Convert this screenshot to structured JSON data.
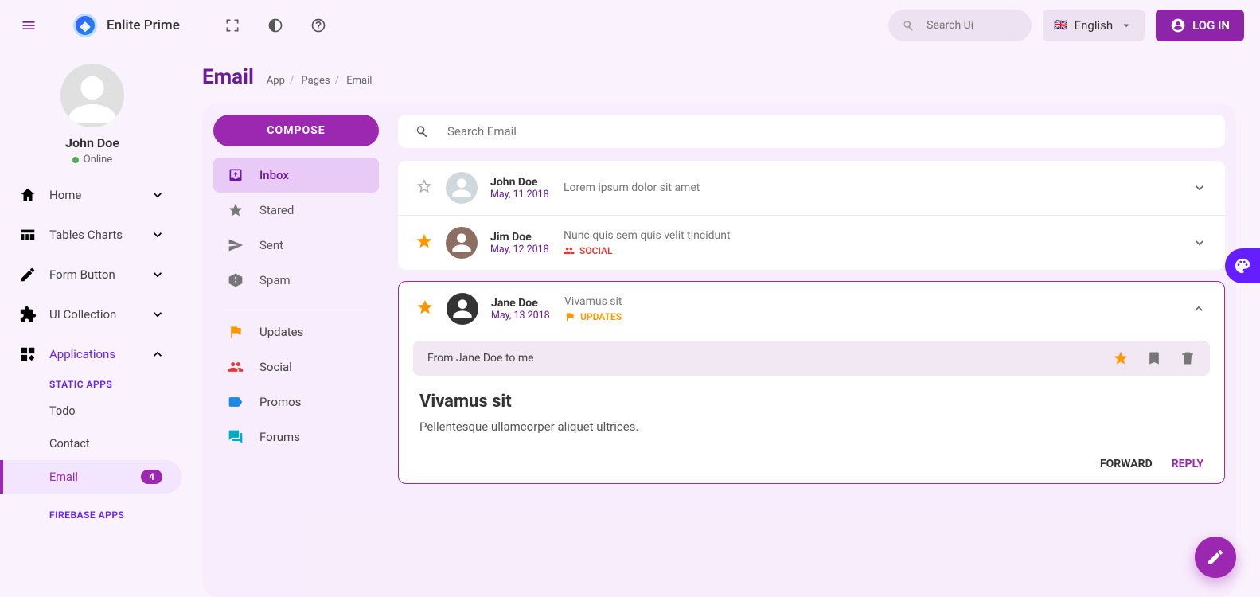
{
  "app": {
    "name": "Enlite Prime"
  },
  "topbar": {
    "search_placeholder": "Search Ui",
    "language": "English",
    "login": "LOG IN"
  },
  "profile": {
    "name": "John Doe",
    "status": "Online"
  },
  "nav": [
    {
      "label": "Home"
    },
    {
      "label": "Tables Charts"
    },
    {
      "label": "Form Button"
    },
    {
      "label": "UI Collection"
    },
    {
      "label": "Applications",
      "open": true
    }
  ],
  "submenus": {
    "header1": "STATIC APPS",
    "items1": [
      {
        "label": "Todo"
      },
      {
        "label": "Contact"
      },
      {
        "label": "Email",
        "badge": "4",
        "selected": true
      }
    ],
    "header2": "FIREBASE APPS"
  },
  "page": {
    "title": "Email",
    "crumbs": [
      "App",
      "Pages",
      "Email"
    ]
  },
  "email": {
    "compose": "COMPOSE",
    "folders": [
      {
        "label": "Inbox",
        "active": true
      },
      {
        "label": "Stared"
      },
      {
        "label": "Sent"
      },
      {
        "label": "Spam"
      }
    ],
    "labels": [
      {
        "label": "Updates",
        "color": "#ff9800"
      },
      {
        "label": "Social",
        "color": "#e53935"
      },
      {
        "label": "Promos",
        "color": "#1e88e5"
      },
      {
        "label": "Forums",
        "color": "#00acc1"
      }
    ],
    "search_placeholder": "Search Email",
    "messages": [
      {
        "from": "John Doe",
        "date": "May, 11 2018",
        "subject": "Lorem ipsum dolor sit amet",
        "starred": false
      },
      {
        "from": "Jim Doe",
        "date": "May, 12 2018",
        "subject": "Nunc quis sem quis velit tincidunt",
        "starred": true,
        "tag": "SOCIAL",
        "tagType": "social"
      }
    ],
    "opened": {
      "from": "Jane Doe",
      "date": "May, 13 2018",
      "subject": "Vivamus sit",
      "tag": "UPDATES",
      "tagType": "updates",
      "from_line": "From Jane Doe to me",
      "body_title": "Vivamus sit",
      "body_text": "Pellentesque ullamcorper aliquet ultrices.",
      "forward": "FORWARD",
      "reply": "REPLY"
    }
  }
}
